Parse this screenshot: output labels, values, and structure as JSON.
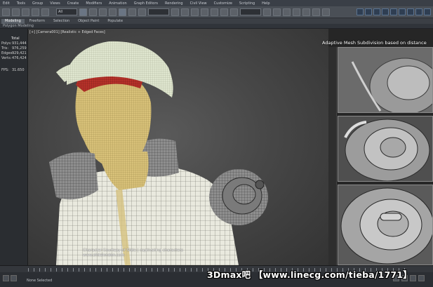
{
  "menu": {
    "items": [
      "Edit",
      "Tools",
      "Group",
      "Views",
      "Create",
      "Modifiers",
      "Animation",
      "Graph Editors",
      "Rendering",
      "Civil View",
      "Customize",
      "Scripting",
      "Help"
    ],
    "selection_set": "All"
  },
  "ribbon": {
    "tabs": [
      "Modeling",
      "Freeform",
      "Selection",
      "Object Paint",
      "Populate"
    ],
    "active_tab": "Modeling",
    "sub_label": "Polygon Modeling"
  },
  "viewport": {
    "label": "[+] [Camera001] [Realistic + Edged Faces]",
    "stats": {
      "header": "Total",
      "rows": [
        {
          "k": "Polys:",
          "v": "931,444"
        },
        {
          "k": "Tris:",
          "v": "976,259"
        },
        {
          "k": "Edges:",
          "v": "929,421"
        },
        {
          "k": "Verts:",
          "v": "476,424"
        }
      ],
      "fps_label": "FPS:",
      "fps_value": "31.650"
    },
    "caption_line1": "Character Courtesy of Slide | captivating characters",
    "caption_line2": "www.slidelondon.com"
  },
  "side_panels": {
    "title": "Adaptive Mesh Subdivision based on distance"
  },
  "status": {
    "selection": "None Selected"
  },
  "watermark": "3Dmax吧 【www.linecg.com/tieba/1771】",
  "colors": {
    "skin": "#d9c27a",
    "cloth": "#e9e9de",
    "armor": "#8e8e8e",
    "hair": "#b8322a",
    "cap": "#dfe6cf"
  }
}
